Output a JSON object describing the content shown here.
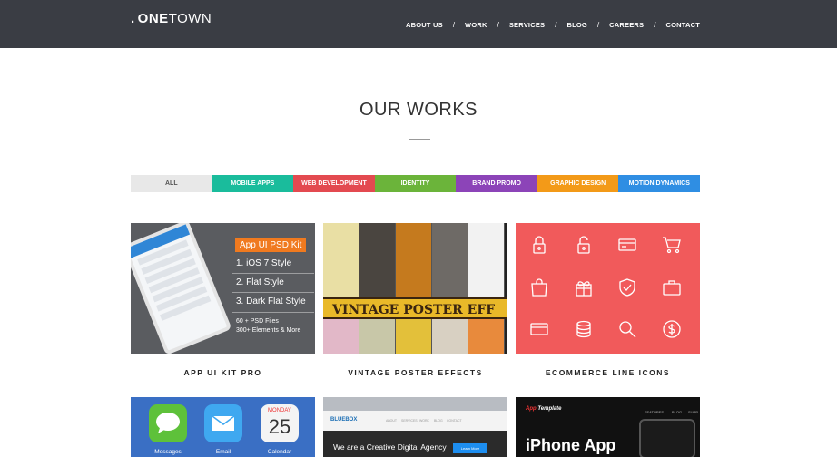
{
  "header": {
    "logo_dot": ".",
    "logo_bold": "ONE",
    "logo_light": "TOWN",
    "nav": [
      "ABOUT US",
      "WORK",
      "SERVICES",
      "BLOG",
      "CAREERS",
      "CONTACT"
    ],
    "separator": "/"
  },
  "section": {
    "title": "OUR WORKS"
  },
  "filters": [
    {
      "label": "ALL",
      "color": "#e8e8e8",
      "text_color": "#555555"
    },
    {
      "label": "MOBILE APPS",
      "color": "#1abc9c",
      "text_color": "#ffffff"
    },
    {
      "label": "WEB DEVELOPMENT",
      "color": "#e34a50",
      "text_color": "#ffffff"
    },
    {
      "label": "IDENTITY",
      "color": "#6bb43a",
      "text_color": "#ffffff"
    },
    {
      "label": "BRAND PROMO",
      "color": "#8c44b8",
      "text_color": "#ffffff"
    },
    {
      "label": "GRAPHIC DESIGN",
      "color": "#f39a18",
      "text_color": "#ffffff"
    },
    {
      "label": "MOTION DYNAMICS",
      "color": "#2f8ee3",
      "text_color": "#ffffff"
    }
  ],
  "works": [
    {
      "caption": "APP UI KIT PRO",
      "badge": "App UI PSD Kit",
      "lines": [
        "1.  iOS 7 Style",
        "2.  Flat Style",
        "3.  Dark Flat Style"
      ],
      "small": [
        "60 + PSD Files",
        "300+ Elements & More"
      ]
    },
    {
      "caption": "VINTAGE POSTER EFFECTS",
      "banner": "VINTAGE POSTER EFF"
    },
    {
      "caption": "ECOMMERCE LINE ICONS",
      "icons": [
        "padlock-closed-icon",
        "padlock-open-icon",
        "credit-card-icon",
        "shopping-cart-icon",
        "shopping-bag-icon",
        "gift-icon",
        "shield-check-icon",
        "briefcase-icon",
        "card-icon",
        "coins-icon",
        "magnifier-icon",
        "dollar-coin-icon"
      ]
    },
    {
      "apps": [
        {
          "label": "Messages",
          "color": "#5ec13a"
        },
        {
          "label": "Email",
          "color": "#3fa8f0"
        },
        {
          "label": "Calendar",
          "color": "#f4f4f4",
          "day": "MONDAY",
          "date": "25"
        }
      ]
    },
    {
      "brand": "BLUEBOX",
      "nav": [
        "ABOUT",
        "SERVICES",
        "WORK",
        "BLOG",
        "CONTACT"
      ],
      "headline": "We are a Creative Digital Agency",
      "button": "Learn More"
    },
    {
      "brand_a": "App",
      "brand_b": " Template",
      "nav": [
        "FEATURES",
        "BLOG",
        "SUPP"
      ],
      "headline": "iPhone App"
    }
  ]
}
